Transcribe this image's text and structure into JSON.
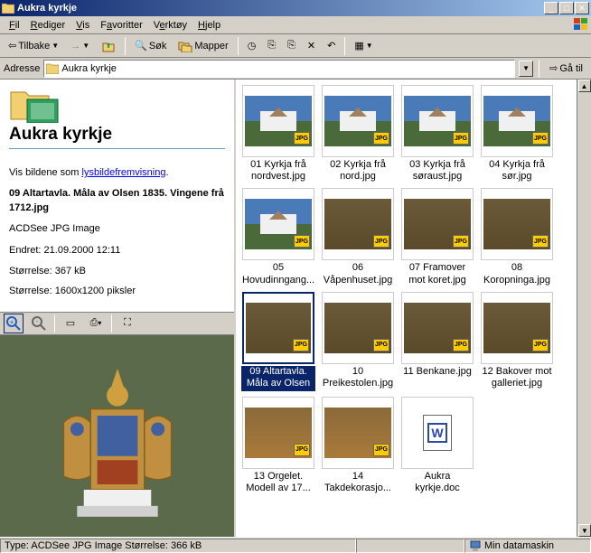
{
  "window": {
    "title": "Aukra kyrkje"
  },
  "menus": [
    "Fil",
    "Rediger",
    "Vis",
    "Favoritter",
    "Verktøy",
    "Hjelp"
  ],
  "toolbar": {
    "back": "Tilbake",
    "search": "Søk",
    "folders": "Mapper"
  },
  "addressbar": {
    "label": "Adresse",
    "value": "Aukra kyrkje",
    "go": "Gå til"
  },
  "folder": {
    "title": "Aukra kyrkje",
    "show_as": "Vis bildene som ",
    "slideshow_link": "lysbildefremvisning",
    "selected_name": "09 Altartavla. Måla av Olsen 1835. Vingene frå 1712.jpg",
    "file_type": "ACDSee JPG Image",
    "modified_label": "Endret: ",
    "modified": "21.09.2000 12:11",
    "size_label": "Størrelse: ",
    "size": "367 kB",
    "dim_label": "Størrelse: ",
    "dimensions": "1600x1200 piksler"
  },
  "thumbnails": [
    {
      "label": "01 Kyrkja frå nordvest.jpg",
      "kind": "ext"
    },
    {
      "label": "02 Kyrkja frå nord.jpg",
      "kind": "ext"
    },
    {
      "label": "03 Kyrkja frå søraust.jpg",
      "kind": "ext"
    },
    {
      "label": "04 Kyrkja frå sør.jpg",
      "kind": "ext"
    },
    {
      "label": "05 Hovudinngang...",
      "kind": "ext"
    },
    {
      "label": "06 Våpenhuset.jpg",
      "kind": "int"
    },
    {
      "label": "07 Framover mot koret.jpg",
      "kind": "int"
    },
    {
      "label": "08 Koropninga.jpg",
      "kind": "int"
    },
    {
      "label": "09 Altartavla. Måla av Olsen ...",
      "kind": "int",
      "selected": true
    },
    {
      "label": "10 Preikestolen.jpg",
      "kind": "int"
    },
    {
      "label": "11 Benkane.jpg",
      "kind": "int"
    },
    {
      "label": "12 Bakover mot galleriet.jpg",
      "kind": "int"
    },
    {
      "label": "13 Orgelet. Modell av 17...",
      "kind": "org"
    },
    {
      "label": "14 Takdekorasjo...",
      "kind": "org"
    },
    {
      "label": "Aukra kyrkje.doc",
      "kind": "doc"
    }
  ],
  "statusbar": {
    "type": "Type: ACDSee JPG Image Størrelse: 366 kB",
    "location": "Min datamaskin"
  }
}
